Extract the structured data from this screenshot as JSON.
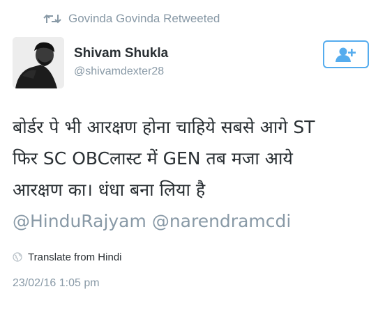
{
  "retweet": {
    "icon": "retweet-icon",
    "label": "Govinda Govinda Retweeted"
  },
  "author": {
    "name": "Shivam Shukla",
    "handle": "@shivamdexter28",
    "avatar_icon": "avatar"
  },
  "follow_button": {
    "icon": "add-user-icon",
    "color": "#55acee"
  },
  "tweet": {
    "lines": [
      "बोर्डर पे भी आरक्षण होना चाहिये सबसे आगे ST",
      "फिर SC OBCलास्ट में GEN तब मजा आये",
      "आरक्षण का। धंधा बना लिया है"
    ],
    "mentions": [
      "@HinduRajyam",
      "@narendramcdi"
    ]
  },
  "translate": {
    "icon": "globe-icon",
    "label": "Translate from Hindi"
  },
  "timestamp": "23/02/16 1:05 pm",
  "colors": {
    "text": "#292f33",
    "muted": "#8899a6",
    "accent": "#55acee"
  }
}
